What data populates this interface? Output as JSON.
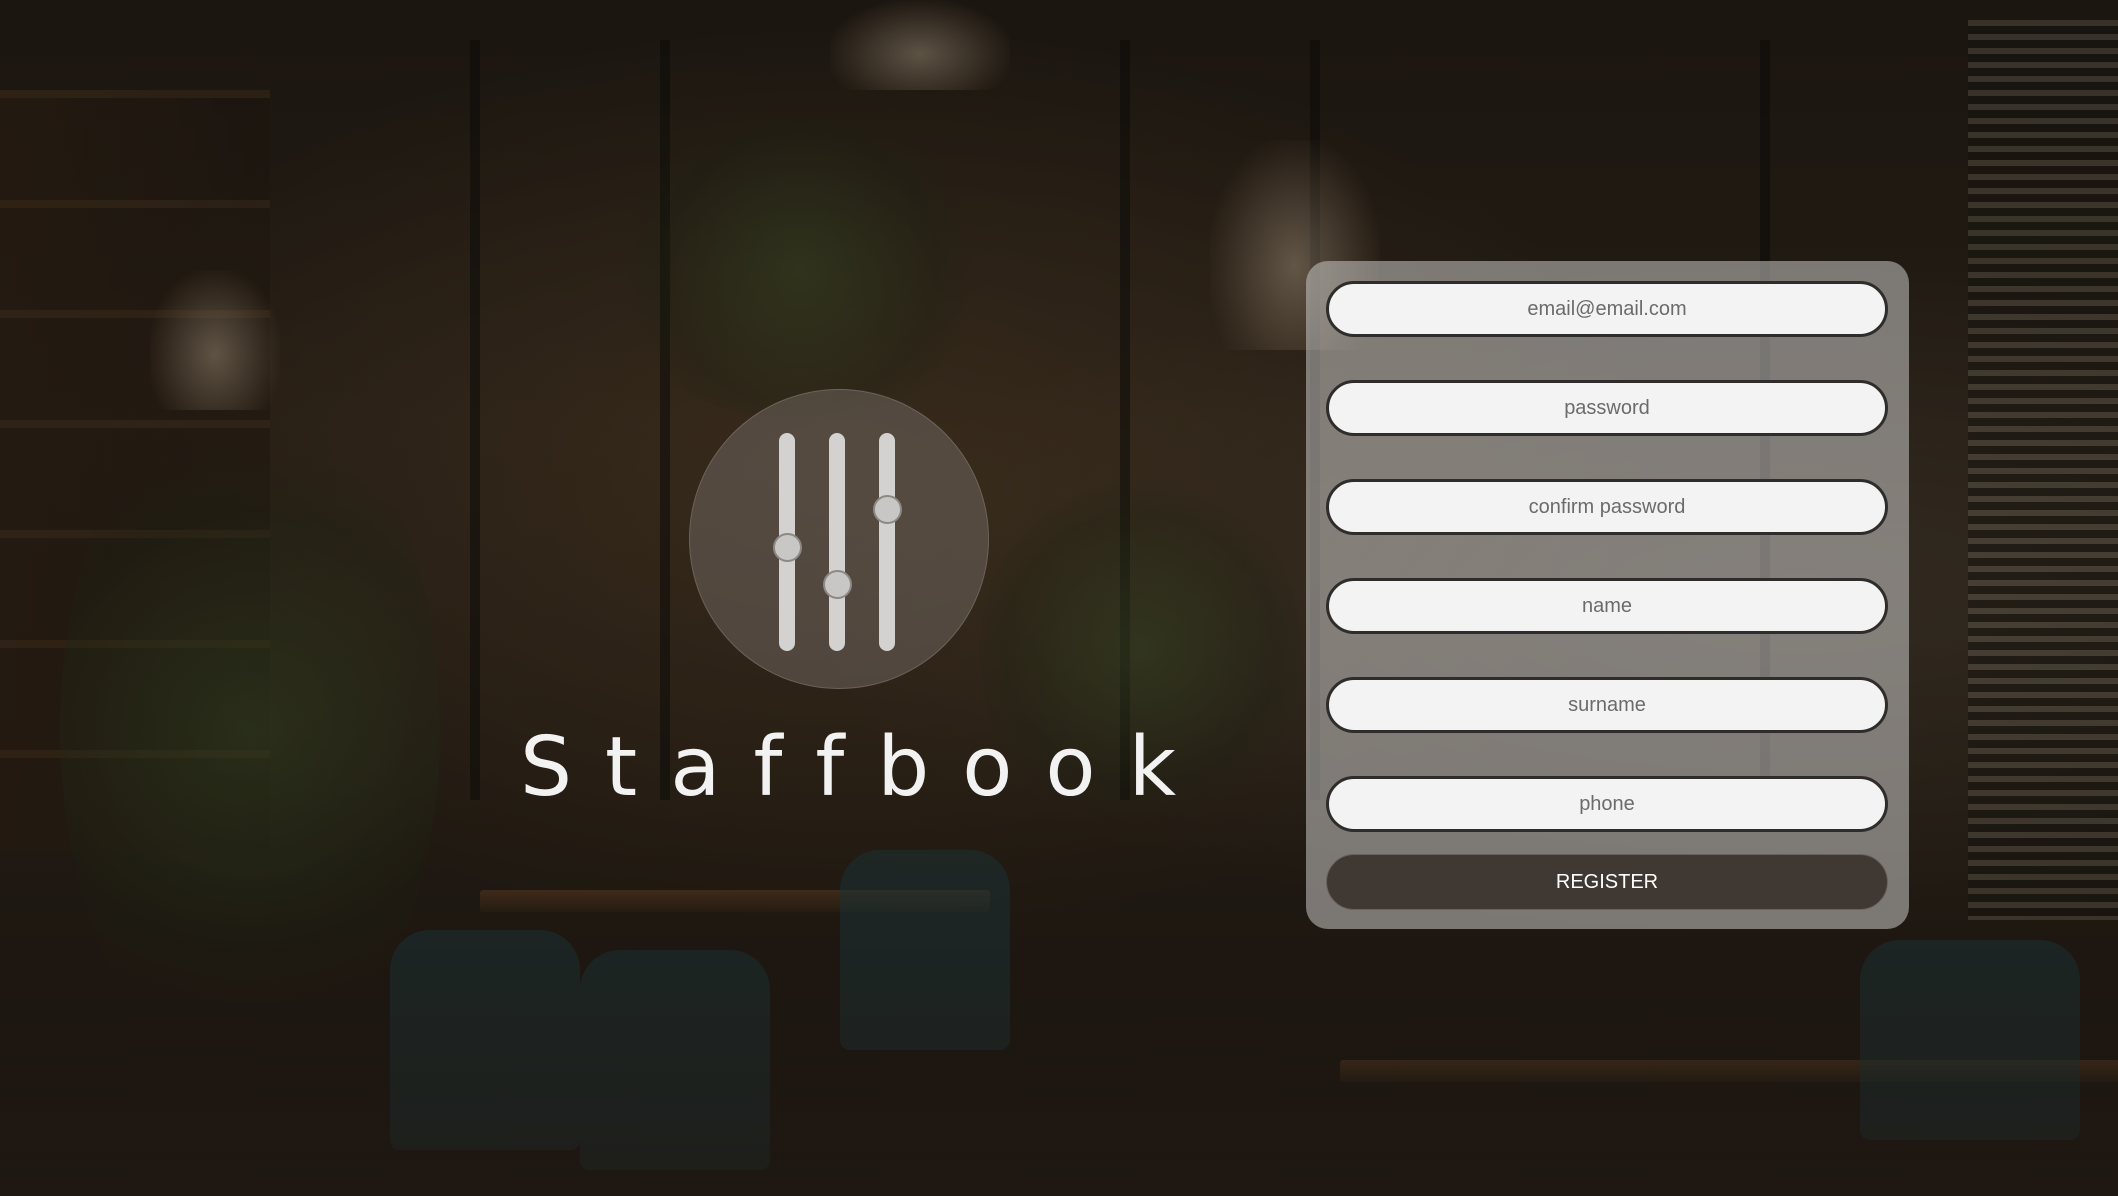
{
  "brand": {
    "name": "Staffbook",
    "logo_icon": "sliders-icon"
  },
  "form": {
    "fields": [
      {
        "id": "email",
        "placeholder": "email@email.com",
        "value": ""
      },
      {
        "id": "password",
        "placeholder": "password",
        "value": ""
      },
      {
        "id": "confirm_password",
        "placeholder": "confirm password",
        "value": ""
      },
      {
        "id": "name",
        "placeholder": "name",
        "value": ""
      },
      {
        "id": "surname",
        "placeholder": "surname",
        "value": ""
      },
      {
        "id": "phone",
        "placeholder": "phone",
        "value": ""
      }
    ],
    "submit_label": "REGISTER"
  },
  "colors": {
    "panel_bg": "#c8c6c4",
    "field_bg": "#f3f3f3",
    "field_border": "#2f2d2b",
    "button_bg": "#403833",
    "button_text": "#ffffff",
    "brand_text": "#f2f2f2"
  }
}
